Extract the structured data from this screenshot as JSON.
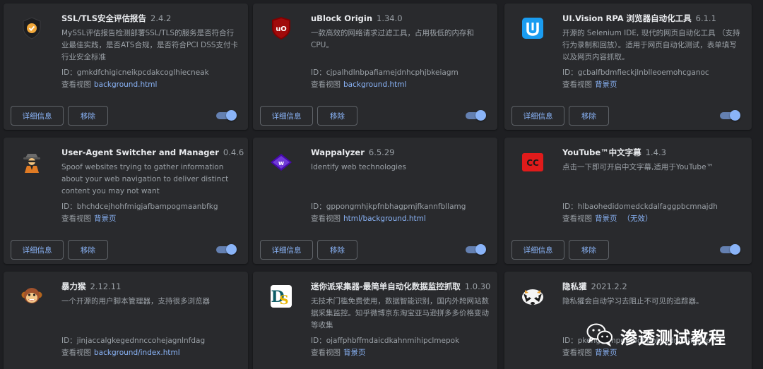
{
  "extensions": [
    {
      "name": "SSL/TLS安全评估报告",
      "version": "2.4.2",
      "desc": "MySSL评估报告检测部署SSL/TLS的服务是否符合行业最佳实践，是否ATS合规，是否符合PCI DSS支付卡行业安全标准",
      "id_label": "ID：",
      "id": "gmkdfchigicneikpcdakcoglhiecneak",
      "view_label": "查看视图",
      "view_link": "background.html",
      "inactive": "",
      "details": "详细信息",
      "remove": "移除",
      "icon": "shield-check-icon"
    },
    {
      "name": "uBlock Origin",
      "version": "1.34.0",
      "desc": "一款高效的网络请求过滤工具，占用极低的内存和CPU。",
      "id_label": "ID：",
      "id": "cjpalhdlnbpafiamejdnhcphjbkeiagm",
      "view_label": "查看视图",
      "view_link": "background.html",
      "inactive": "",
      "details": "详细信息",
      "remove": "移除",
      "icon": "ublock-shield-icon"
    },
    {
      "name": "UI.Vision RPA 浏览器自动化工具",
      "version": "6.1.1",
      "desc": "开源的 Selenium IDE, 现代的网页自动化工具 （支持行为录制和回放）。适用于网页自动化测试，表单填写以及网页内容抓取。",
      "id_label": "ID：",
      "id": "gcbalfbdmfieckjlnblleoemohcganoc",
      "view_label": "查看视图",
      "view_link": "背景页",
      "inactive": "",
      "details": "详细信息",
      "remove": "移除",
      "icon": "uivision-icon"
    },
    {
      "name": "User-Agent Switcher and Manager",
      "version": "0.4.6",
      "desc": "Spoof websites trying to gather information about your web navigation to deliver distinct content you may not want",
      "id_label": "ID：",
      "id": "bhchdcejhohfmigjafbampogmaanbfkg",
      "view_label": "查看视图",
      "view_link": "背景页",
      "inactive": "",
      "details": "详细信息",
      "remove": "移除",
      "icon": "spy-agent-icon"
    },
    {
      "name": "Wappalyzer",
      "version": "6.5.29",
      "desc": "Identify web technologies",
      "id_label": "ID：",
      "id": "gppongmhjkpfnbhagpmjfkannfbllamg",
      "view_label": "查看视图",
      "view_link": "html/background.html",
      "inactive": "",
      "details": "详细信息",
      "remove": "移除",
      "icon": "wappalyzer-icon"
    },
    {
      "name": "YouTube™中文字幕",
      "version": "1.4.3",
      "desc": "点击一下即可开启中文字幕,适用于YouTube™",
      "id_label": "ID：",
      "id": "hlbaohedidomedckdalfaggpbcmnajdh",
      "view_label": "查看视图",
      "view_link": "背景页",
      "inactive": "（无效）",
      "details": "详细信息",
      "remove": "移除",
      "icon": "cc-subtitle-icon"
    },
    {
      "name": "暴力猴",
      "version": "2.12.11",
      "desc": "一个开源的用户脚本管理器，支持很多浏览器",
      "id_label": "ID：",
      "id": "jinjaccalgkegednnccohejagnlnfdag",
      "view_label": "查看视图",
      "view_link": "background/index.html",
      "inactive": "",
      "details": "详细信息",
      "remove": "移除",
      "icon": "monkey-icon"
    },
    {
      "name": "迷你派采集器-最简单自动化数据监控抓取",
      "version": "1.0.30",
      "desc": "无技术门槛免费使用，数据智能识别，国内外跨网站数据采集监控。知乎微博京东淘宝亚马逊拼多多价格变动等收集",
      "id_label": "ID：",
      "id": "ojaffphbffmdaicdkahnmihipclmepok",
      "view_label": "查看视图",
      "view_link": "背景页",
      "inactive": "",
      "details": "详细信息",
      "remove": "移除",
      "icon": "ds-logo-icon"
    },
    {
      "name": "隐私獾",
      "version": "2021.2.2",
      "desc": "隐私獾会自动学习去阻止不可见的追踪器。",
      "id_label": "ID：",
      "id": "pkehgijcmpdhfbdbbnkijodmdjhbjlgp",
      "view_label": "查看视图",
      "view_link": "背景页",
      "inactive": "",
      "details": "详细信息",
      "remove": "移除",
      "icon": "badger-icon"
    }
  ],
  "watermark": {
    "text": "渗透测试教程",
    "icon": "wechat-icon"
  },
  "colors": {
    "accent": "#8ab4f8",
    "card": "#292a2d",
    "page": "#1e1f22"
  }
}
